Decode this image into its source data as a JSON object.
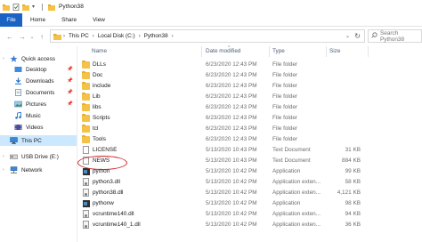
{
  "window": {
    "title": "Python38"
  },
  "ribbon": {
    "tabs": [
      "File",
      "Home",
      "Share",
      "View"
    ]
  },
  "address": {
    "crumbs": [
      "This PC",
      "Local Disk (C:)",
      "Python38"
    ],
    "search_placeholder": "Search Python38"
  },
  "sidebar": {
    "quick_access": "Quick access",
    "items": [
      "Desktop",
      "Downloads",
      "Documents",
      "Pictures",
      "Music",
      "Videos"
    ],
    "this_pc": "This PC",
    "usb": "USB Drive (E:)",
    "network": "Network"
  },
  "columns": {
    "name": "Name",
    "date": "Date modified",
    "type": "Type",
    "size": "Size"
  },
  "files": [
    {
      "name": "DLLs",
      "date": "6/23/2020 12:43 PM",
      "type": "File folder",
      "size": "",
      "icon": "folder"
    },
    {
      "name": "Doc",
      "date": "6/23/2020 12:43 PM",
      "type": "File folder",
      "size": "",
      "icon": "folder"
    },
    {
      "name": "include",
      "date": "6/23/2020 12:43 PM",
      "type": "File folder",
      "size": "",
      "icon": "folder"
    },
    {
      "name": "Lib",
      "date": "6/23/2020 12:43 PM",
      "type": "File folder",
      "size": "",
      "icon": "folder"
    },
    {
      "name": "libs",
      "date": "6/23/2020 12:43 PM",
      "type": "File folder",
      "size": "",
      "icon": "folder"
    },
    {
      "name": "Scripts",
      "date": "6/23/2020 12:43 PM",
      "type": "File folder",
      "size": "",
      "icon": "folder"
    },
    {
      "name": "tcl",
      "date": "6/23/2020 12:43 PM",
      "type": "File folder",
      "size": "",
      "icon": "folder"
    },
    {
      "name": "Tools",
      "date": "6/23/2020 12:43 PM",
      "type": "File folder",
      "size": "",
      "icon": "folder"
    },
    {
      "name": "LICENSE",
      "date": "5/13/2020 10:43 PM",
      "type": "Text Document",
      "size": "31 KB",
      "icon": "doc"
    },
    {
      "name": "NEWS",
      "date": "5/13/2020 10:43 PM",
      "type": "Text Document",
      "size": "884 KB",
      "icon": "doc"
    },
    {
      "name": "python",
      "date": "5/13/2020 10:42 PM",
      "type": "Application",
      "size": "99 KB",
      "icon": "python"
    },
    {
      "name": "python3.dll",
      "date": "5/13/2020 10:42 PM",
      "type": "Application exten...",
      "size": "58 KB",
      "icon": "dll"
    },
    {
      "name": "python38.dll",
      "date": "5/13/2020 10:42 PM",
      "type": "Application exten...",
      "size": "4,121 KB",
      "icon": "dll"
    },
    {
      "name": "pythonw",
      "date": "5/13/2020 10:42 PM",
      "type": "Application",
      "size": "98 KB",
      "icon": "python"
    },
    {
      "name": "vcruntime140.dll",
      "date": "5/13/2020 10:42 PM",
      "type": "Application exten...",
      "size": "94 KB",
      "icon": "dll"
    },
    {
      "name": "vcruntime140_1.dll",
      "date": "5/13/2020 10:42 PM",
      "type": "Application exten...",
      "size": "36 KB",
      "icon": "dll"
    }
  ],
  "colors": {
    "file_tab": "#1a63c2",
    "selected_nav": "#cce8ff",
    "highlight_circle": "#d1262b"
  }
}
